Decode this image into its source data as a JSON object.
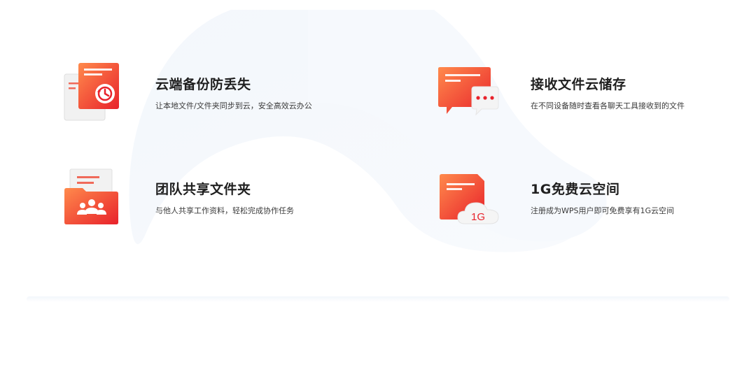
{
  "features": [
    {
      "title": "云端备份防丢失",
      "description": "让本地文件/文件夹同步到云，安全高效云办公",
      "icon": "cloud-backup-icon"
    },
    {
      "title": "接收文件云储存",
      "description": "在不同设备随时查看各聊天工具接收到的文件",
      "icon": "chat-file-icon"
    },
    {
      "title": "团队共享文件夹",
      "description": "与他人共享工作资料，轻松完成协作任务",
      "icon": "team-folder-icon"
    },
    {
      "title": "1G免费云空间",
      "description": "注册成为WPS用户即可免费享有1G云空间",
      "icon": "cloud-storage-icon",
      "badge": "1G"
    }
  ],
  "colors": {
    "accent_light": "#ff7a45",
    "accent_dark": "#e8222b",
    "title": "#1f1f1f",
    "text": "#3a3a3a"
  }
}
